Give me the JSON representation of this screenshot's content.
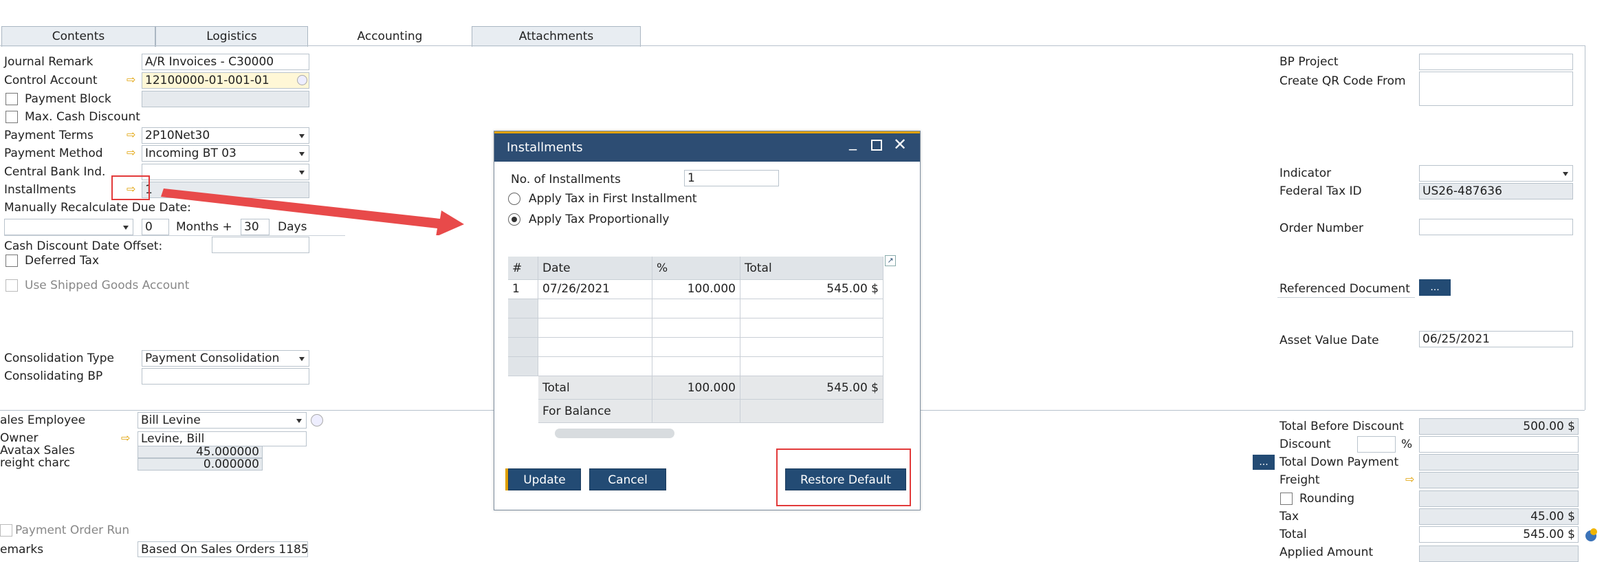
{
  "tabs": [
    "Contents",
    "Logistics",
    "Accounting",
    "Attachments"
  ],
  "left": {
    "journal_remark_label": "Journal Remark",
    "journal_remark": "A/R Invoices - C30000",
    "control_account_label": "Control Account",
    "control_account": "12100000-01-001-01",
    "payment_block_label": "Payment Block",
    "max_cash_discount_label": "Max. Cash Discount",
    "payment_terms_label": "Payment Terms",
    "payment_terms": "2P10Net30",
    "payment_method_label": "Payment Method",
    "payment_method": "Incoming BT 03",
    "central_bank_label": "Central Bank Ind.",
    "central_bank": "",
    "installments_label": "Installments",
    "installments": "1",
    "recalc_label": "Manually Recalculate Due Date:",
    "recalc_months": "0",
    "months_label": "Months +",
    "recalc_days": "30",
    "days_label": "Days",
    "cash_disc_offset_label": "Cash Discount Date Offset:",
    "cash_disc_offset": "",
    "deferred_tax_label": "Deferred Tax",
    "use_shipped_label": "Use Shipped Goods Account",
    "consolidation_type_label": "Consolidation Type",
    "consolidation_type": "Payment Consolidation",
    "consolidating_bp_label": "Consolidating BP",
    "consolidating_bp": "",
    "sales_employee_label": "ales Employee",
    "sales_employee": "Bill Levine",
    "owner_label": "Owner",
    "owner": "Levine, Bill",
    "avatax_label": "Avatax Sales",
    "avatax": "45.000000",
    "freight_charge_label": "reight charc",
    "freight_charge": "0.000000",
    "payment_order_run_label": "Payment Order Run",
    "remarks_label": "emarks",
    "remarks": "Based On Sales Orders 1185."
  },
  "right": {
    "bp_project_label": "BP Project",
    "bp_project": "",
    "create_qr_label": "Create QR Code From",
    "create_qr": "",
    "indicator_label": "Indicator",
    "indicator": "",
    "federal_tax_label": "Federal Tax ID",
    "federal_tax": "US26-487636",
    "order_number_label": "Order Number",
    "order_number": "",
    "referenced_doc_label": "Referenced Document",
    "dots": "...",
    "asset_value_date_label": "Asset Value Date",
    "asset_value_date": "06/25/2021",
    "total_before_discount_label": "Total Before Discount",
    "total_before_discount": "500.00 $",
    "discount_label": "Discount",
    "discount_pct": "",
    "percent": "%",
    "discount_val": "",
    "total_down_payment_label": "Total Down Payment",
    "total_down_payment": "",
    "freight_label": "Freight",
    "freight": "",
    "rounding_label": "Rounding",
    "rounding": "",
    "tax_label": "Tax",
    "tax": "45.00 $",
    "total_label": "Total",
    "total": "545.00 $",
    "applied_amount_label": "Applied Amount",
    "applied_amount": ""
  },
  "modal": {
    "title": "Installments",
    "no_installments_label": "No. of Installments",
    "no_installments": "1",
    "apply_first_label": "Apply Tax in First Installment",
    "apply_prop_label": "Apply Tax Proportionally",
    "headers": [
      "#",
      "Date",
      "%",
      "Total"
    ],
    "rows": [
      {
        "n": "1",
        "date": "07/26/2021",
        "pct": "100.000",
        "total": "545.00 $"
      }
    ],
    "total_label": "Total",
    "total_pct": "100.000",
    "total_amt": "545.00 $",
    "for_balance_label": "For Balance",
    "update": "Update",
    "cancel": "Cancel",
    "restore": "Restore Default"
  },
  "colors": {
    "accent": "#e0a000",
    "header": "#2d4d73",
    "button": "#234b74",
    "annotation": "#e23a3a"
  }
}
